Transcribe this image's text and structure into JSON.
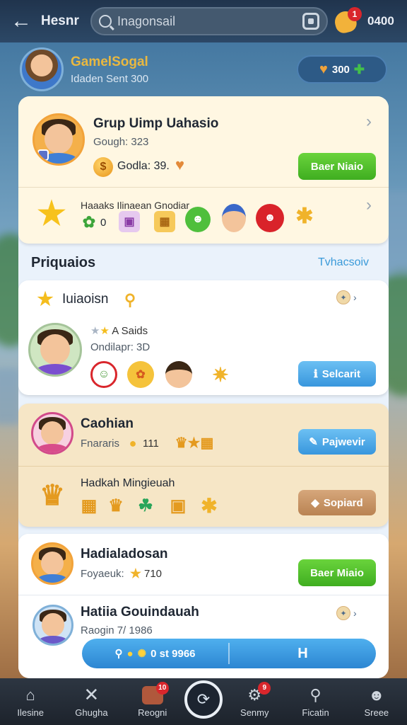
{
  "topbar": {
    "title": "Hesnr",
    "search_placeholder": "Inagonsail",
    "notification_count": "1",
    "coins": "0400"
  },
  "profile": {
    "name": "GamelSogal",
    "subtitle": "Idaden Sent 300",
    "pill_value": "300"
  },
  "card1": {
    "title": "Grup Uimp Uahasio",
    "sub": "Gough: 323",
    "coins_label": "Godla: 39.",
    "button": "Baer Niaio",
    "rewards_label": "Haaaks Ilinaean Gnodiar",
    "rewards_count": "0"
  },
  "section": {
    "title": "Priquaios",
    "link": "Tvhacsoiv"
  },
  "card2": {
    "title": "Iuiaoisn",
    "rating": "A Saids",
    "sub": "Ondilapr: 3D",
    "button": "Selcarit"
  },
  "card3": {
    "title": "Caohian",
    "sub": "Fnararis",
    "value": "111",
    "button": "Pajwevir",
    "row2_title": "Hadkah Mingieuah",
    "row2_button": "Sopiard"
  },
  "card4": {
    "title": "Hadialadosan",
    "sub": "Foyaeuk:",
    "value": "710",
    "button": "Baer Miaio"
  },
  "card5": {
    "title": "Hatiia Gouindauah",
    "sub": "Raogin 7/ 1986",
    "pill_left": "0 st 9966",
    "pill_right": "H"
  },
  "nav": {
    "items": [
      {
        "label": "Ilesine",
        "icon": "home-icon"
      },
      {
        "label": "Ghugha",
        "icon": "close-icon"
      },
      {
        "label": "Reogni",
        "icon": "avatar-icon",
        "badge": "10"
      },
      {
        "label": "",
        "icon": "center-action-icon"
      },
      {
        "label": "Senmy",
        "icon": "settings-icon",
        "badge": "9"
      },
      {
        "label": "Ficatin",
        "icon": "search-icon"
      },
      {
        "label": "Sreee",
        "icon": "profile-icon"
      }
    ]
  },
  "colors": {
    "accent_green": "#3fae20",
    "accent_blue": "#3896dd",
    "gold": "#e9b840"
  }
}
